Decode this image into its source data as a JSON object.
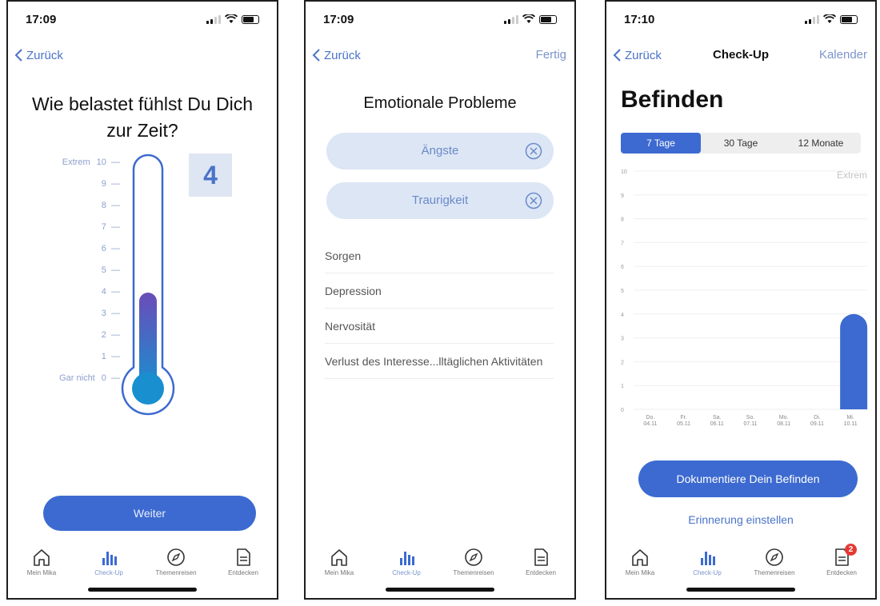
{
  "screen1": {
    "time": "17:09",
    "back_label": "Zurück",
    "question": "Wie belastet fühlst Du Dich zur Zeit?",
    "scale_top_label": "Extrem",
    "scale_bottom_label": "Gar nicht",
    "scale_ticks": [
      "10",
      "9",
      "8",
      "7",
      "6",
      "5",
      "4",
      "3",
      "2",
      "1",
      "0"
    ],
    "level": 4,
    "level_max": 10,
    "value_display": "4",
    "continue_label": "Weiter"
  },
  "screen2": {
    "time": "17:09",
    "back_label": "Zurück",
    "done_label": "Fertig",
    "title": "Emotionale Probleme",
    "selected": [
      "Ängste",
      "Traurigkeit"
    ],
    "options": [
      "Sorgen",
      "Depression",
      "Nervosität",
      "Verlust des Interesse...lltäglichen Aktivitäten"
    ]
  },
  "screen3": {
    "time": "17:10",
    "back_label": "Zurück",
    "nav_title": "Check-Up",
    "calendar_label": "Kalender",
    "title": "Befinden",
    "segments": [
      "7 Tage",
      "30 Tage",
      "12 Monate"
    ],
    "active_segment": 0,
    "document_label": "Dokumentiere Dein Befinden",
    "reminder_label": "Erinnerung einstellen",
    "badge_count": "2"
  },
  "chart_data": {
    "type": "bar",
    "categories": [
      "Do.\n04.11",
      "Fr.\n05.11",
      "Sa.\n06.11",
      "So.\n07.11",
      "Mo.\n08.11",
      "Di.\n09.11",
      "Mi.\n10.11"
    ],
    "values": [
      null,
      null,
      null,
      null,
      null,
      null,
      4
    ],
    "ylim": [
      0,
      10
    ],
    "yticks": [
      "0",
      "1",
      "2",
      "3",
      "4",
      "5",
      "6",
      "7",
      "8",
      "9",
      "10"
    ],
    "annotation": "Extrem",
    "grid": true,
    "bar_color": "#3c6ad0"
  },
  "tabbar": {
    "items": [
      {
        "label": "Mein Mika",
        "icon": "home-icon"
      },
      {
        "label": "Check-Up",
        "icon": "bar-chart-icon"
      },
      {
        "label": "Themenreisen",
        "icon": "compass-icon"
      },
      {
        "label": "Entdecken",
        "icon": "document-icon"
      }
    ],
    "active_index": 1
  },
  "colors": {
    "accent": "#3c6ad0",
    "link": "#4a73c9",
    "chip": "#dce6f5",
    "thermo_top": "#6a4cb8",
    "thermo_bottom": "#1a8fd0"
  }
}
